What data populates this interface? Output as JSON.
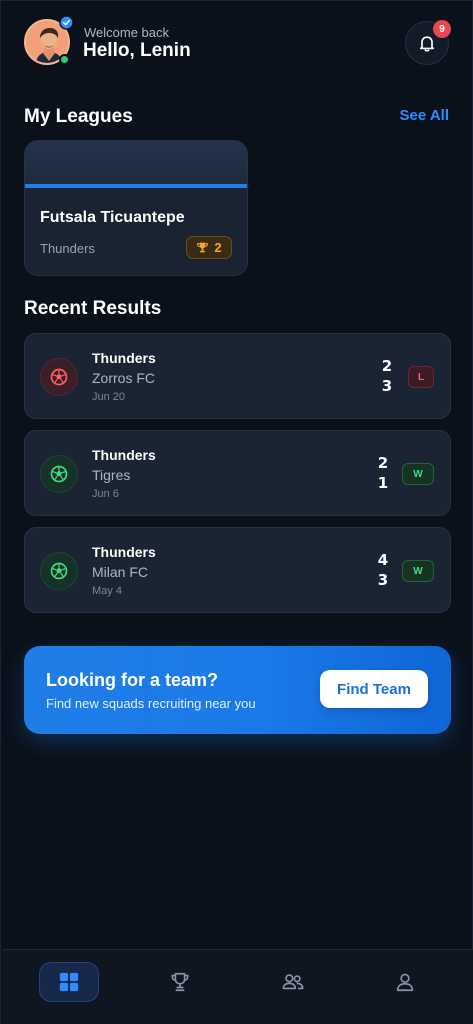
{
  "header": {
    "welcome": "Welcome back",
    "greeting": "Hello, Lenin",
    "notification_count": "9"
  },
  "leagues": {
    "title": "My Leagues",
    "see_all": "See All",
    "items": [
      {
        "name": "Futsala Ticuantepe",
        "team": "Thunders",
        "trophies": "2"
      }
    ]
  },
  "results": {
    "title": "Recent Results",
    "items": [
      {
        "home": "Thunders",
        "away": "Zorros FC",
        "date": "Jun 20",
        "home_score": "2",
        "away_score": "3",
        "outcome": "L"
      },
      {
        "home": "Thunders",
        "away": "Tigres",
        "date": "Jun 6",
        "home_score": "2",
        "away_score": "1",
        "outcome": "W"
      },
      {
        "home": "Thunders",
        "away": "Milan FC",
        "date": "May 4",
        "home_score": "4",
        "away_score": "3",
        "outcome": "W"
      }
    ]
  },
  "promo": {
    "title": "Looking for a team?",
    "subtitle": "Find new squads recruiting near you",
    "button": "Find Team"
  },
  "nav": {
    "items": [
      {
        "icon": "grid-icon",
        "active": true
      },
      {
        "icon": "trophy-icon",
        "active": false
      },
      {
        "icon": "users-icon",
        "active": false
      },
      {
        "icon": "profile-icon",
        "active": false
      }
    ]
  },
  "colors": {
    "accent": "#1e7fe8",
    "win": "#3ddc84",
    "loss": "#ff5d67",
    "trophy": "#f5a623",
    "background": "#0b111b"
  }
}
